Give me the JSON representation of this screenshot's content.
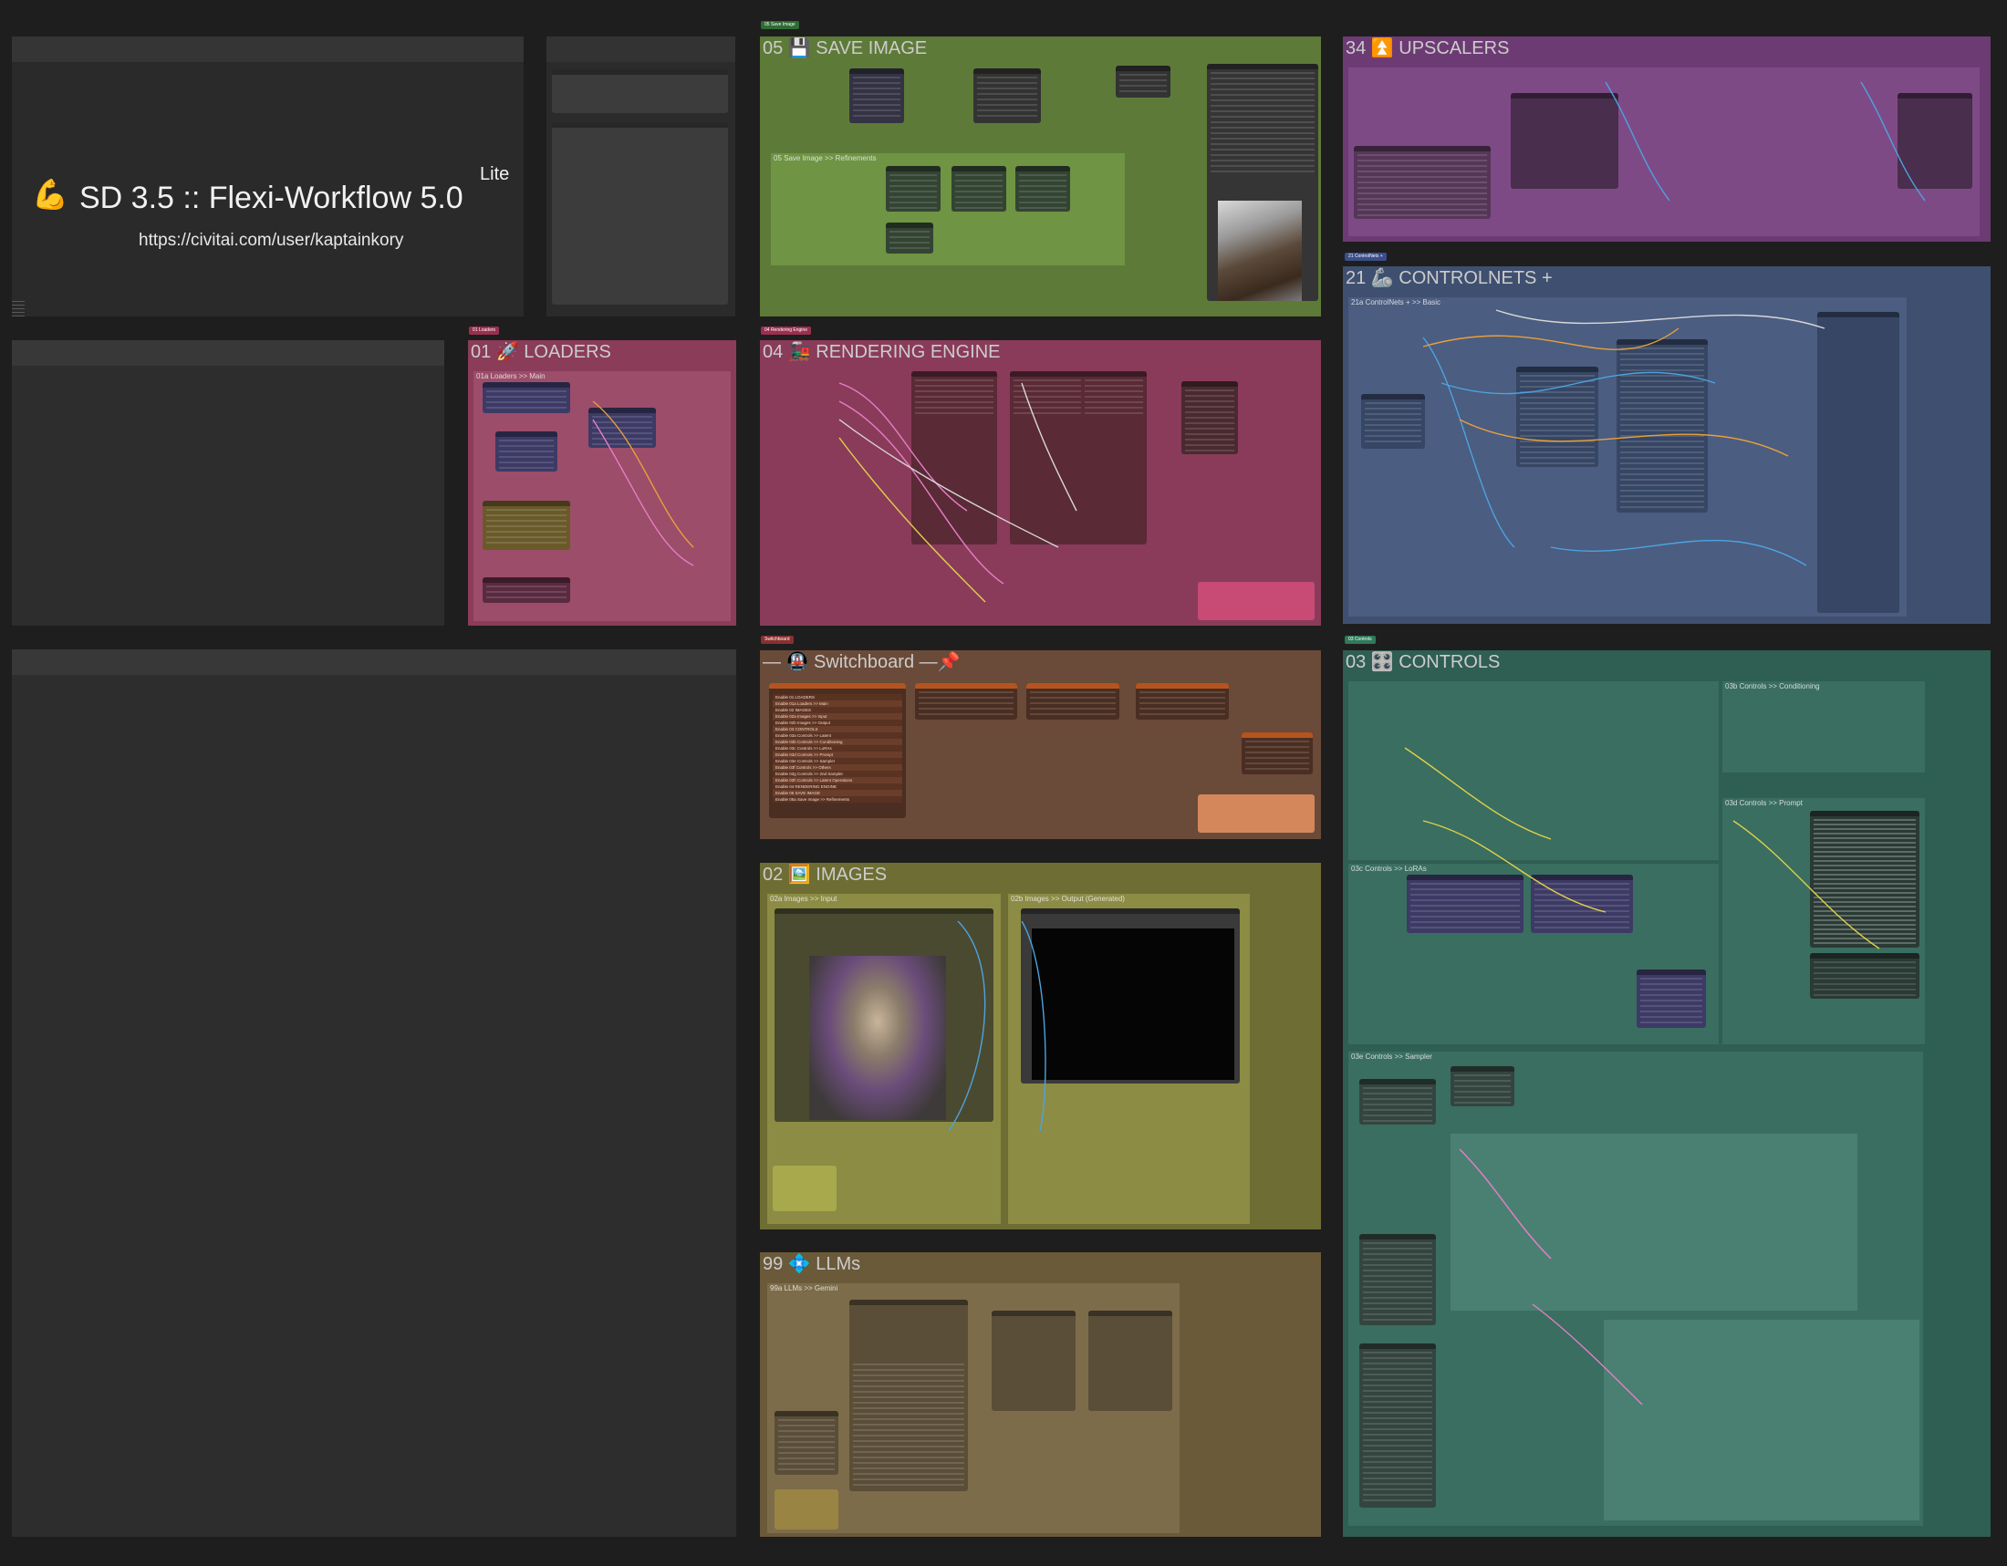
{
  "title_card": {
    "pin_icon": "📌",
    "emoji": "💪",
    "title": "SD 3.5 :: Flexi-Workflow 5.0",
    "edition": "Lite",
    "url": "https://civitai.com/user/kaptainkory"
  },
  "start_here": {
    "label": "— 💪 Start Here —📌"
  },
  "groups": {
    "save_image": {
      "title": "05 💾 SAVE IMAGE",
      "color": "#5e7a38",
      "sub_refinements": "05 Save Image >> Refinements"
    },
    "upscalers": {
      "title": "34 ⏫ UPSCALERS",
      "color": "#6d3b73"
    },
    "controlnets": {
      "title": "21 🦾 CONTROLNETS +",
      "color": "#3f4f6f",
      "sub_basic": "21a ControlNets +  >> Basic"
    },
    "loaders": {
      "title": "01 🚀 LOADERS",
      "color": "#8a3c58",
      "sub_main": "01a Loaders >> Main"
    },
    "rendering": {
      "title": "04 🚂 RENDERING ENGINE",
      "color": "#8a3b5a"
    },
    "switchboard": {
      "title": "— 🚇 Switchboard —📌",
      "color": "#6a4a38"
    },
    "images": {
      "title": "02 🖼️ IMAGES",
      "color": "#6e6e34",
      "sub_input": "02a Images >> Input",
      "sub_output": "02b Images >> Output (Generated)"
    },
    "llms": {
      "title": "99 💠 LLMs",
      "color": "#6a5a3a",
      "sub_gemini": "99a LLMs >> Gemini"
    },
    "controls": {
      "title": "03 🎛️ CONTROLS",
      "color": "#2f5e52",
      "sub_conditioning": "03b Controls >> Conditioning",
      "sub_prompt": "03d Controls >> Prompt",
      "sub_loras": "03c Controls >> LoRAs",
      "sub_sampler": "03e Controls >> Sampler"
    }
  },
  "group_tags": {
    "save_image": "05 Save Image",
    "controlnets": "21 ControlNets +",
    "loaders": "01 Loaders",
    "rendering": "04 Rendering Engine",
    "switchboard": "Switchboard",
    "controls": "03 Controls"
  },
  "switchboard_rows": [
    "Enable 01 LOADERS",
    "Enable 01a Loaders >> Main",
    "Enable 02 IMAGES",
    "Enable 02a Images >> Input",
    "Enable 02b Images >> Output",
    "Enable 03 CONTROLS",
    "Enable 03a Controls >> Latent",
    "Enable 03b Controls >> Conditioning",
    "Enable 03c Controls >> LoRAs",
    "Enable 03d Controls >> Prompt",
    "Enable 03e Controls >> Sampler",
    "Enable 03f Controls >> Others",
    "Enable 03g Controls >> 2nd Sampler",
    "Enable 03h Controls >> Latent Operations",
    "Enable 04 RENDERING ENGINE",
    "Enable 05 SAVE IMAGE",
    "Enable 05a Save Image >> Refinements"
  ],
  "colors": {
    "background": "#1e1e1e",
    "wire_blue": "#4da3e0",
    "wire_orange": "#e8a03a",
    "wire_pink": "#e67ec7",
    "wire_yellow": "#e0d04a",
    "wire_white": "#d8d8d8"
  },
  "icons": [
    "pin-icon",
    "flexed-bicep-icon",
    "floppy-disk-icon",
    "up-arrows-icon",
    "rocket-icon",
    "locomotive-icon",
    "metro-icon",
    "framed-picture-icon",
    "diamond-icon",
    "control-knobs-icon"
  ]
}
